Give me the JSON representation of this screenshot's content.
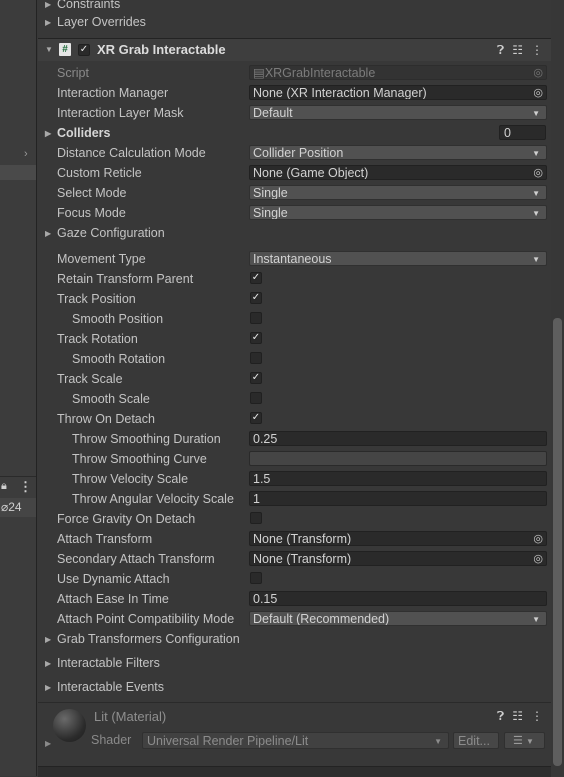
{
  "left_panel": {
    "visible_count": "24"
  },
  "top_items": [
    {
      "label": "Constraints"
    },
    {
      "label": "Layer Overrides"
    }
  ],
  "component": {
    "title": "XR Grab Interactable",
    "enabled": true,
    "icons": [
      "help-icon",
      "settings-sliders-icon",
      "more-options-icon"
    ]
  },
  "properties": {
    "script": {
      "label": "Script",
      "value": "XRGrabInteractable"
    },
    "interaction_manager": {
      "label": "Interaction Manager",
      "value": "None (XR Interaction Manager)"
    },
    "interaction_layer_mask": {
      "label": "Interaction Layer Mask",
      "value": "Default"
    },
    "colliders": {
      "label": "Colliders",
      "value": "0"
    },
    "distance_calculation_mode": {
      "label": "Distance Calculation Mode",
      "value": "Collider Position"
    },
    "custom_reticle": {
      "label": "Custom Reticle",
      "value": "None (Game Object)"
    },
    "select_mode": {
      "label": "Select Mode",
      "value": "Single"
    },
    "focus_mode": {
      "label": "Focus Mode",
      "value": "Single"
    },
    "gaze_configuration": {
      "label": "Gaze Configuration"
    },
    "movement_type": {
      "label": "Movement Type",
      "value": "Instantaneous"
    },
    "retain_transform_parent": {
      "label": "Retain Transform Parent",
      "checked": true
    },
    "track_position": {
      "label": "Track Position",
      "checked": true
    },
    "smooth_position": {
      "label": "Smooth Position",
      "checked": false
    },
    "track_rotation": {
      "label": "Track Rotation",
      "checked": true
    },
    "smooth_rotation": {
      "label": "Smooth Rotation",
      "checked": false
    },
    "track_scale": {
      "label": "Track Scale",
      "checked": true
    },
    "smooth_scale": {
      "label": "Smooth Scale",
      "checked": false
    },
    "throw_on_detach": {
      "label": "Throw On Detach",
      "checked": true
    },
    "throw_smoothing_duration": {
      "label": "Throw Smoothing Duration",
      "value": "0.25"
    },
    "throw_smoothing_curve": {
      "label": "Throw Smoothing Curve"
    },
    "throw_velocity_scale": {
      "label": "Throw Velocity Scale",
      "value": "1.5"
    },
    "throw_angular_velocity_scale": {
      "label": "Throw Angular Velocity Scale",
      "value": "1"
    },
    "force_gravity_on_detach": {
      "label": "Force Gravity On Detach",
      "checked": false
    },
    "attach_transform": {
      "label": "Attach Transform",
      "value": "None (Transform)"
    },
    "secondary_attach_transform": {
      "label": "Secondary Attach Transform",
      "value": "None (Transform)"
    },
    "use_dynamic_attach": {
      "label": "Use Dynamic Attach",
      "checked": false
    },
    "attach_ease_in_time": {
      "label": "Attach Ease In Time",
      "value": "0.15"
    },
    "attach_point_compatibility_mode": {
      "label": "Attach Point Compatibility Mode",
      "value": "Default (Recommended)"
    }
  },
  "foldouts": [
    {
      "label": "Grab Transformers Configuration"
    },
    {
      "label": "Interactable Filters"
    },
    {
      "label": "Interactable Events"
    }
  ],
  "material": {
    "name": "Lit (Material)",
    "shader_label": "Shader",
    "shader_value": "Universal Render Pipeline/Lit",
    "edit_label": "Edit..."
  }
}
